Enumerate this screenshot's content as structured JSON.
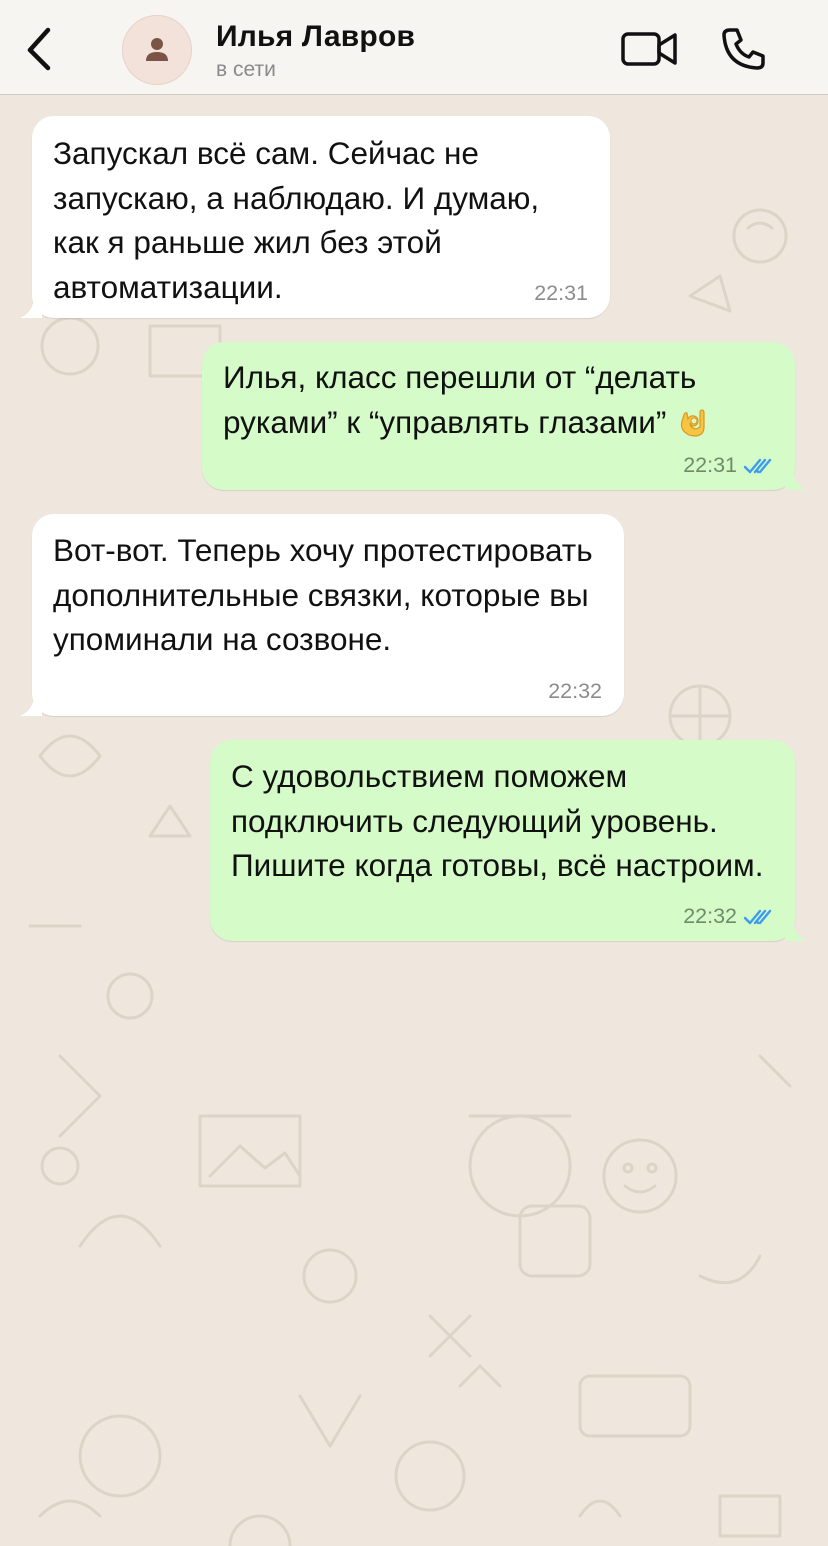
{
  "header": {
    "contact_name": "Илья Лавров",
    "contact_status": "в сети",
    "icons": {
      "back": "chevron-left-icon",
      "avatar": "person-icon",
      "video": "video-camera-icon",
      "call": "phone-icon"
    }
  },
  "messages": [
    {
      "direction": "incoming",
      "text": "Запускал всё сам. Сейчас не запускаю, а наблюдаю. И думаю, как я раньше жил без этой автоматизации.",
      "time": "22:31"
    },
    {
      "direction": "outgoing",
      "text": "Илья, класс перешли от “делать руками” к “управлять глазами”",
      "emoji": "ok-hand-icon",
      "time": "22:31",
      "status": "read"
    },
    {
      "direction": "incoming",
      "text": "Вот-вот. Теперь хочу протестировать дополнительные связки, которые вы упоминали на созвоне.",
      "time": "22:32"
    },
    {
      "direction": "outgoing",
      "text": "С удовольствием поможем подключить следующий уровень. Пишите когда готовы, всё настроим.",
      "time": "22:32",
      "status": "read"
    }
  ],
  "colors": {
    "background": "#efe7de",
    "incoming_bubble": "#ffffff",
    "outgoing_bubble": "#d4fbc8",
    "read_ticks": "#3b9cf0",
    "header_bg": "#f7f5f2"
  }
}
